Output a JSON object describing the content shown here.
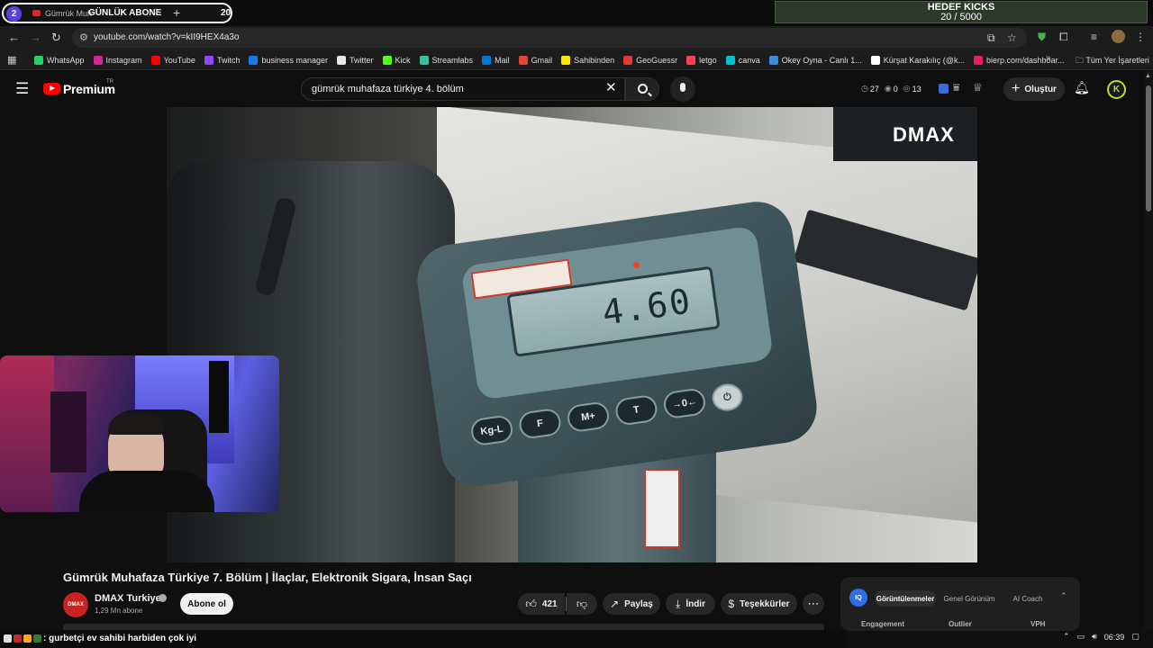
{
  "browser": {
    "tab_count": "2",
    "tab_title": "Gümrük Muh",
    "tab_overlay": "GÜNLÜK ABONE",
    "tab_overlay_value": "20",
    "url": "youtube.com/watch?v=kII9HEX4a3o"
  },
  "goal": {
    "title": "HEDEF KICKS",
    "value": "20 / 5000"
  },
  "bookmarks": [
    {
      "label": "WhatsApp",
      "color": "#25d366"
    },
    {
      "label": "Instagram",
      "color": "#d6249f"
    },
    {
      "label": "YouTube",
      "color": "#ff0000"
    },
    {
      "label": "Twitch",
      "color": "#9146ff"
    },
    {
      "label": "business manager",
      "color": "#1877f2"
    },
    {
      "label": "Twitter",
      "color": "#e7e7e7"
    },
    {
      "label": "Kick",
      "color": "#53fc18"
    },
    {
      "label": "Streamlabs",
      "color": "#31c3a2"
    },
    {
      "label": "Mail",
      "color": "#0078d4"
    },
    {
      "label": "Gmail",
      "color": "#ea4335"
    },
    {
      "label": "Sahibinden",
      "color": "#ffe800"
    },
    {
      "label": "GeoGuessr",
      "color": "#e53935"
    },
    {
      "label": "letgo",
      "color": "#ff3f55"
    },
    {
      "label": "canva",
      "color": "#00c4cc"
    },
    {
      "label": "Okey Oyna - Canlı 1...",
      "color": "#3a8dde"
    },
    {
      "label": "Kürşat Karakılıç (@k...",
      "color": "#ffffff"
    },
    {
      "label": "bierp.com/dashboar...",
      "color": "#e91e63"
    }
  ],
  "bookmarks_folder": "Tüm Yer İşaretleri",
  "youtube": {
    "brand": "Premium",
    "country": "TR",
    "search_query": "gümrük muhafaza türkiye 4. bölüm",
    "stats": {
      "views": "27",
      "a": "0",
      "b": "13"
    },
    "create_label": "Oluştur",
    "avatar_letter": "K"
  },
  "video": {
    "scale_reading": "4.60",
    "watermark": "DMAX",
    "title": "Gümrük Muhafaza Türkiye 7. Bölüm | İlaçlar, Elektronik Sigara, İnsan Saçı",
    "channel_name": "DMAX Turkiye",
    "channel_avatar": "DMAX",
    "subscribers": "1,29 Mn abone",
    "subscribe_label": "Abone ol",
    "likes": "421",
    "share_label": "Paylaş",
    "download_label": "İndir",
    "thanks_label": "Teşekkürler"
  },
  "scale_keys": [
    "Kg-L",
    "F",
    "M+",
    "T",
    "→0←"
  ],
  "ext_panel": {
    "badge": "IQ",
    "tabs": [
      "Görüntülenmeler",
      "Genel Görünüm",
      "AI Coach"
    ],
    "columns": [
      "Engagement",
      "Outlier",
      "VPH"
    ]
  },
  "chat": {
    "message": ": gurbetçi ev sahibi harbiden çok iyi"
  },
  "taskbar": {
    "time": "06:39"
  }
}
